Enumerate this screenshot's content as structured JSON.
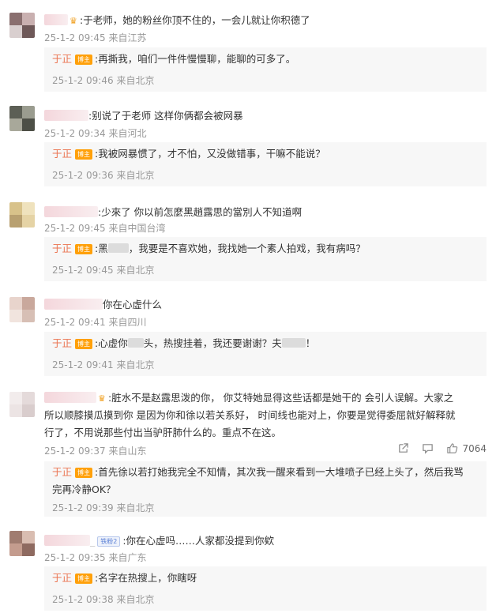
{
  "comments": [
    {
      "text": ":于老师，她的粉丝你顶不住的，一会儿就让你积德了",
      "time": "25-1-2 09:45",
      "location": "来自江苏",
      "reply": {
        "author": "于正",
        "badge": "博主",
        "text": ":再撕我，咱们一件件慢慢聊，能聊的可多了。",
        "time": "25-1-2 09:46",
        "location": "来自北京"
      }
    },
    {
      "text": ":别说了于老师 这样你俩都会被网暴",
      "time": "25-1-2 09:34",
      "location": "来自河北",
      "reply": {
        "author": "于正",
        "badge": "博主",
        "text": ":我被网暴惯了，才不怕，又没做错事，干嘛不能说？",
        "time": "25-1-2 09:36",
        "location": "来自北京"
      }
    },
    {
      "text": ":少來了 你以前怎麼黑趙露思的當別人不知道啊",
      "time": "25-1-2 09:45",
      "location": "来自中国台湾",
      "reply": {
        "author": "于正",
        "badge": "博主",
        "text_a": ":黑",
        "text_b": "，我要是不喜欢她，我找她一个素人拍戏，我有病吗？",
        "time": "25-1-2 09:45",
        "location": "来自北京"
      }
    },
    {
      "text": "你在心虚什么",
      "time": "25-1-2 09:41",
      "location": "来自四川",
      "reply": {
        "author": "于正",
        "badge": "博主",
        "text_a": ":心虚你",
        "text_b": "头，热搜挂着，我还要谢谢？夫",
        "text_c": "！",
        "time": "25-1-2 09:41",
        "location": "来自北京"
      }
    },
    {
      "text_l1": ":脏水不是赵露思泼的你， 你艾特她显得这些话都是她干的 会引人误解。大家之",
      "text_l2": "所以顺膝摸瓜摸到你 是因为你和徐以若关系好， 时间线也能对上，你要是觉得委屈就好解释就",
      "text_l3": "行了，不用说那些付出当驴肝肺什么的。重点不在这。",
      "time": "25-1-2 09:37",
      "location": "来自山东",
      "likes": "7064",
      "reply": {
        "author": "于正",
        "badge": "博主",
        "text_l1": ":首先徐以若打她我完全不知情，其次我一醒来看到一大堆喷子已经上头了，然后我骂",
        "text_l2": "完再冷静OK？",
        "time": "25-1-2 09:39",
        "location": "来自北京"
      }
    },
    {
      "fan_badge": "铁粉2",
      "text": ":你在心虚吗……人家都没提到你欸",
      "time": "25-1-2 09:35",
      "location": "来自广东",
      "reply": {
        "author": "于正",
        "badge": "博主",
        "text": ":名字在热搜上，你瞎呀",
        "time": "25-1-2 09:38",
        "location": "来自北京"
      }
    }
  ],
  "colors": {
    "author": "#eb7350",
    "badge": "#ffa00a",
    "meta": "#999999"
  },
  "icons": [
    "share-icon",
    "comment-icon",
    "like-icon",
    "crown-icon"
  ]
}
